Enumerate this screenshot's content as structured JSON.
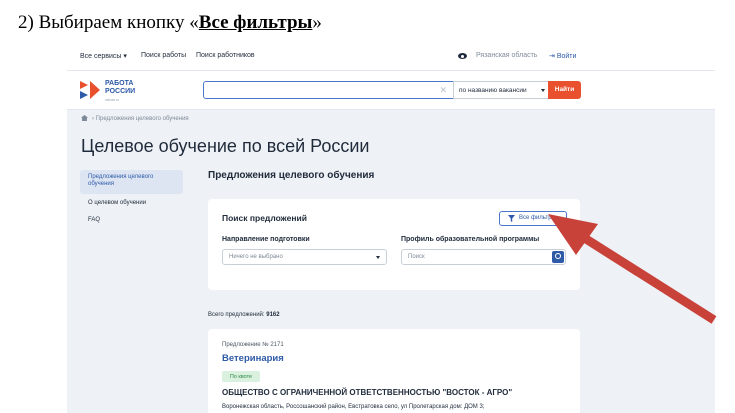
{
  "doc": {
    "heading_prefix": "2) Выбираем кнопку «",
    "heading_bold": "Все фильтры",
    "heading_suffix": "»"
  },
  "topbar": {
    "all_services": "Все сервисы ▾",
    "job_search": "Поиск работы",
    "worker_search": "Поиск работников",
    "region": "Рязанская область",
    "login": "Войти",
    "login_icon": "login-arrow-icon"
  },
  "header": {
    "logo_line1": "РАБОТА",
    "logo_line2": "РОССИИ",
    "logo_sub": "rabota.ru",
    "search_placeholder": "",
    "search_mode": "по названию вакансии",
    "find_label": "Найти"
  },
  "breadcrumb": {
    "item": "Предложения целевого обучения"
  },
  "page": {
    "title": "Целевое обучение по всей России"
  },
  "sidebar": {
    "items": [
      {
        "label_line1": "Предложения целевого",
        "label_line2": "обучения"
      },
      {
        "label": "О целевом обучении"
      },
      {
        "label": "FAQ"
      }
    ]
  },
  "main": {
    "section_title": "Предложения целевого обучения",
    "search_card": {
      "title": "Поиск предложений",
      "filters_button": "Все фильтры",
      "direction_label": "Направление подготовки",
      "direction_value": "Ничего не выбрано",
      "profile_label": "Профиль образовательной программы",
      "profile_placeholder": "Поиск"
    },
    "total_label": "Всего предложений:",
    "total_value": "9162",
    "vacancy": {
      "number": "Предложение № 2171",
      "title": "Ветеринария",
      "badge": "По квоте",
      "org": "ОБЩЕСТВО С ОГРАНИЧЕННОЙ ОТВЕТСТВЕННОСТЬЮ \"ВОСТОК - АГРО\"",
      "address": "Воронежская область, Россошанский район, Евстратовка село, ул Пролетарская дом: ДОМ 3;"
    }
  },
  "colors": {
    "accent": "#2e5aa8",
    "find_button": "#e8502e",
    "arrow": "#c8423a",
    "badge_bg": "#d9f1de"
  }
}
